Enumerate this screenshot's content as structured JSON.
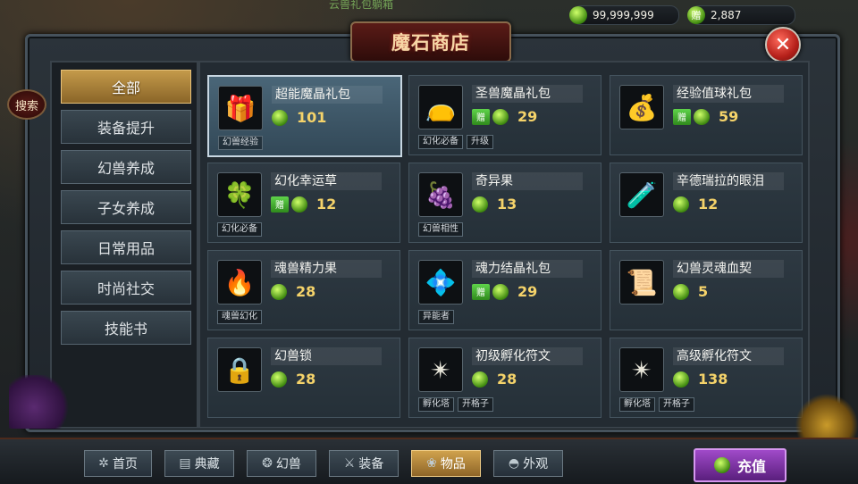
{
  "currency": {
    "gems": "99,999,999",
    "bound_gems": "2,887",
    "bound_tag": "赠"
  },
  "top_partial_text": "云兽礼包躺箱",
  "title": "魔石商店",
  "close_glyph": "✕",
  "search_label": "搜索",
  "categories": [
    {
      "label": "全部",
      "active": true
    },
    {
      "label": "装备提升",
      "active": false
    },
    {
      "label": "幻兽养成",
      "active": false
    },
    {
      "label": "子女养成",
      "active": false
    },
    {
      "label": "日常用品",
      "active": false
    },
    {
      "label": "时尚社交",
      "active": false
    },
    {
      "label": "技能书",
      "active": false
    }
  ],
  "items": [
    {
      "name": "超能魔晶礼包",
      "price": "101",
      "gift": false,
      "tags": [
        "幻兽经验"
      ],
      "icon": "treasure-chest-icon",
      "glyph": "🎁",
      "selected": true
    },
    {
      "name": "圣兽魔晶礼包",
      "price": "29",
      "gift": true,
      "tags": [
        "幻化必备",
        "升级"
      ],
      "icon": "pouch-icon",
      "glyph": "👝",
      "selected": false
    },
    {
      "name": "经验值球礼包",
      "price": "59",
      "gift": true,
      "tags": [],
      "icon": "exp-chest-icon",
      "glyph": "💰",
      "selected": false
    },
    {
      "name": "幻化幸运草",
      "price": "12",
      "gift": true,
      "tags": [
        "幻化必备"
      ],
      "icon": "clover-icon",
      "glyph": "🍀",
      "selected": false
    },
    {
      "name": "奇异果",
      "price": "13",
      "gift": false,
      "tags": [
        "幻兽相性"
      ],
      "icon": "fruit-icon",
      "glyph": "🍇",
      "selected": false
    },
    {
      "name": "辛德瑞拉的眼泪",
      "price": "12",
      "gift": false,
      "tags": [],
      "icon": "potion-icon",
      "glyph": "🧪",
      "selected": false
    },
    {
      "name": "魂兽精力果",
      "price": "28",
      "gift": false,
      "tags": [
        "魂兽幻化"
      ],
      "icon": "flame-fruit-icon",
      "glyph": "🔥",
      "selected": false
    },
    {
      "name": "魂力结晶礼包",
      "price": "29",
      "gift": true,
      "tags": [
        "异能者"
      ],
      "icon": "crystal-ring-icon",
      "glyph": "💠",
      "selected": false
    },
    {
      "name": "幻兽灵魂血契",
      "price": "5",
      "gift": false,
      "tags": [],
      "icon": "scroll-icon",
      "glyph": "📜",
      "selected": false
    },
    {
      "name": "幻兽锁",
      "price": "28",
      "gift": false,
      "tags": [],
      "icon": "padlock-icon",
      "glyph": "🔒",
      "selected": false
    },
    {
      "name": "初级孵化符文",
      "price": "28",
      "gift": false,
      "tags": [
        "孵化塔",
        "开格子"
      ],
      "icon": "rune-gold-icon",
      "glyph": "✴",
      "selected": false
    },
    {
      "name": "高级孵化符文",
      "price": "138",
      "gift": false,
      "tags": [
        "孵化塔",
        "开格子"
      ],
      "icon": "rune-silver-icon",
      "glyph": "✴",
      "selected": false
    }
  ],
  "nav": [
    {
      "label": "首页",
      "icon": "pinwheel-icon",
      "glyph": "✲",
      "active": false
    },
    {
      "label": "典藏",
      "icon": "book-icon",
      "glyph": "▤",
      "active": false
    },
    {
      "label": "幻兽",
      "icon": "beast-icon",
      "glyph": "❂",
      "active": false
    },
    {
      "label": "装备",
      "icon": "weapon-icon",
      "glyph": "⚔",
      "active": false
    },
    {
      "label": "物品",
      "icon": "tulip-icon",
      "glyph": "❀",
      "active": true
    },
    {
      "label": "外观",
      "icon": "outfit-icon",
      "glyph": "◓",
      "active": false
    }
  ],
  "recharge_label": "充值"
}
